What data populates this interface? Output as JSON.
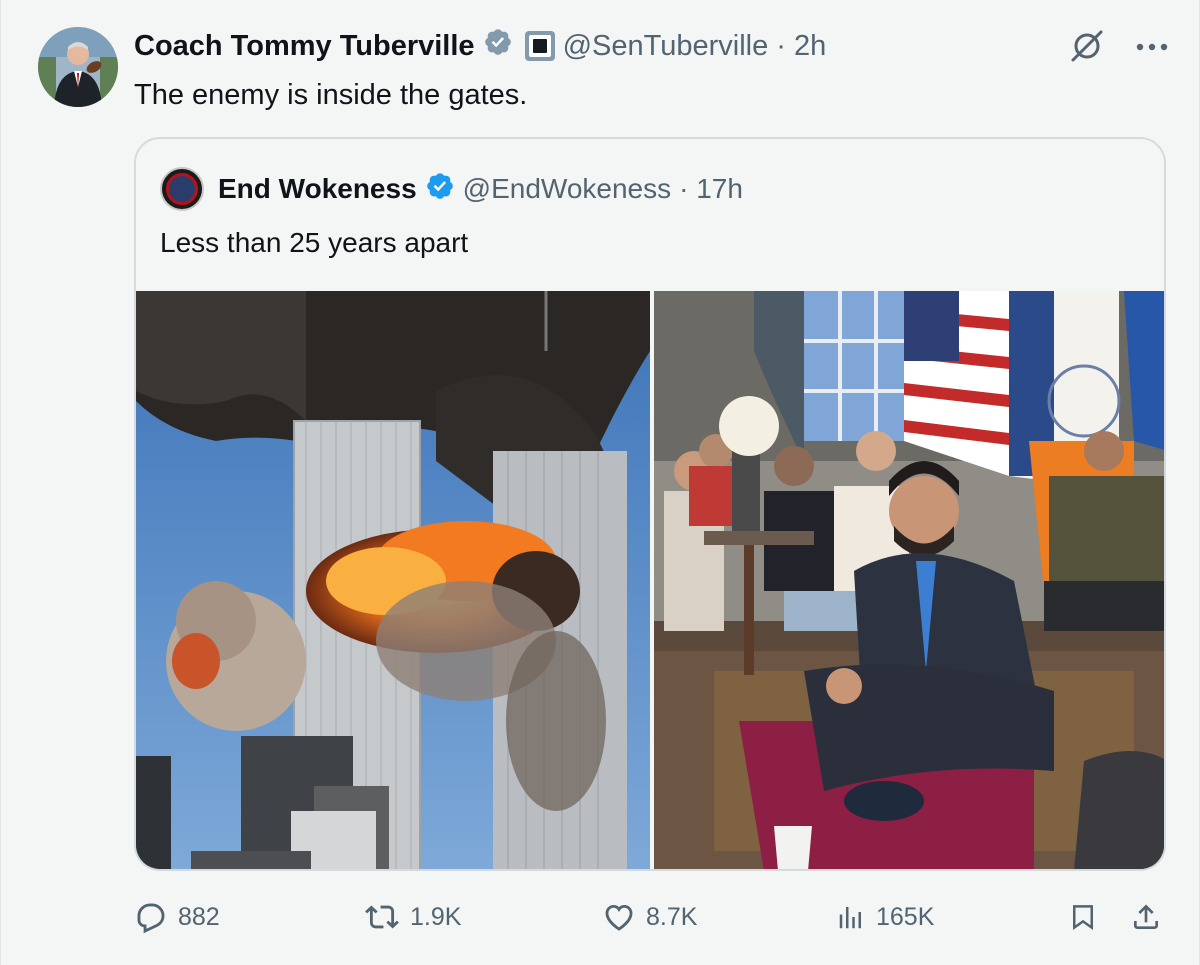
{
  "author": {
    "display_name": "Coach Tommy Tuberville",
    "handle": "@SenTuberville",
    "time": "· 2h"
  },
  "tweet": {
    "text": "The enemy is inside the gates."
  },
  "quoted": {
    "display_name": "End Wokeness",
    "handle": "@EndWokeness",
    "time": "· 17h",
    "text": "Less than 25 years apart"
  },
  "actions": {
    "replies": "882",
    "reposts": "1.9K",
    "likes": "8.7K",
    "views": "165K"
  },
  "icons": {
    "verified": "verified-badge-icon",
    "gov": "government-badge-icon",
    "grok": "grok-icon",
    "more": "more-icon",
    "reply": "reply-icon",
    "repost": "repost-icon",
    "like": "like-icon",
    "views": "views-icon",
    "bookmark": "bookmark-icon",
    "share": "share-icon"
  },
  "colors": {
    "verified_blue": "#1d9bf0",
    "muted_text": "#536471"
  }
}
